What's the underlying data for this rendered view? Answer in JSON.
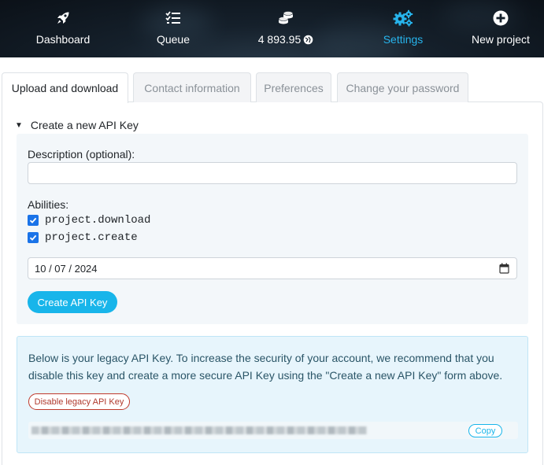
{
  "nav": {
    "dashboard": "Dashboard",
    "queue": "Queue",
    "balance": "4 893.95",
    "settings": "Settings",
    "new_project": "New project",
    "active_color": "#27b4ec"
  },
  "tabs": [
    {
      "label": "Upload and download",
      "active": true
    },
    {
      "label": "Contact information",
      "active": false
    },
    {
      "label": "Preferences",
      "active": false
    },
    {
      "label": "Change your password",
      "active": false
    }
  ],
  "api_key_form": {
    "summary": "Create a new API Key",
    "description_label": "Description (optional):",
    "description_value": "",
    "abilities_label": "Abilities:",
    "abilities": [
      {
        "label": "project.download",
        "checked": true
      },
      {
        "label": "project.create",
        "checked": true
      }
    ],
    "expiry_date": "10 / 07 / 2024",
    "submit_label": "Create API Key"
  },
  "legacy": {
    "message": "Below is your legacy API Key. To increase the security of your account, we recommend that you disable this key and create a more secure API Key using the \"Create a new API Key\" form above.",
    "disable_label": "Disable legacy API Key",
    "copy_label": "Copy"
  },
  "colors": {
    "primary": "#18b5ea",
    "danger": "#b03a2e",
    "checkbox": "#1a73e8"
  }
}
